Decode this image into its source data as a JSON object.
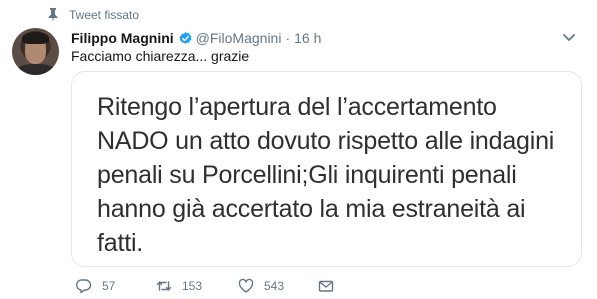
{
  "pinned": {
    "label": "Tweet fissato",
    "icon": "pin-icon"
  },
  "author": {
    "name": "Filippo Magnini",
    "handle": "@FiloMagnini",
    "separator": "·",
    "time": "16 h",
    "verified_icon": "verified-badge-icon"
  },
  "tweet": {
    "text": "Facciamo chiarezza... grazie",
    "image_text": "Ritengo l’apertura del l’accertamento NADO un atto dovuto rispetto alle indagini penali su Porcellini;Gli inquirenti penali hanno già accertato la mia estraneità ai fatti."
  },
  "actions": {
    "reply_count": "57",
    "retweet_count": "153",
    "like_count": "543"
  },
  "colors": {
    "text": "#14171a",
    "secondary": "#657786",
    "verified": "#1da1f2",
    "border": "#e1e8ed"
  }
}
